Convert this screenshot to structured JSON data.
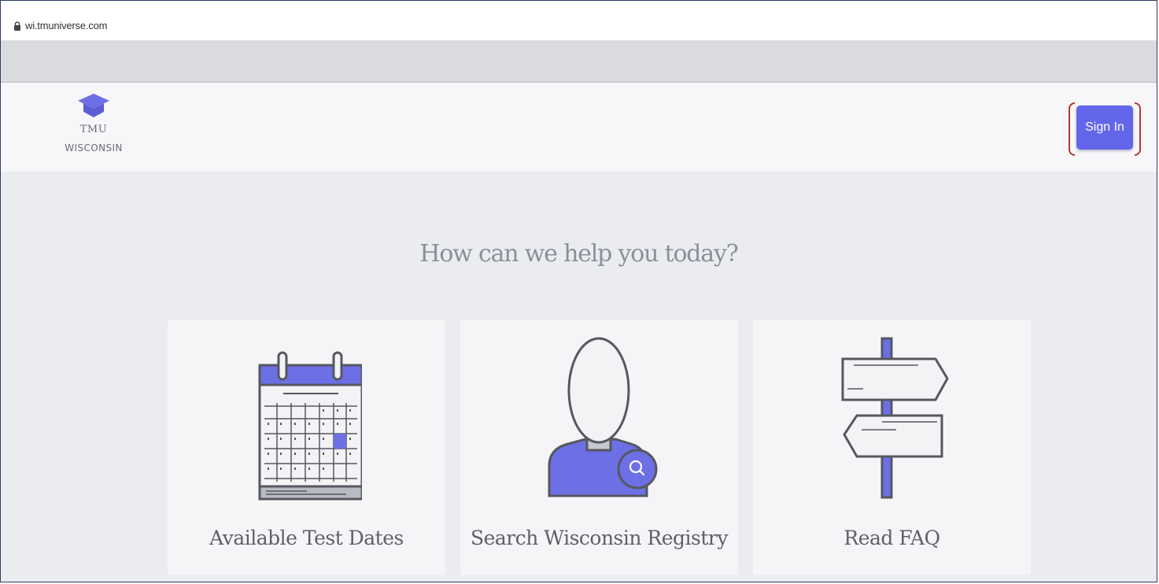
{
  "browser": {
    "url": "wi.tmuniverse.com"
  },
  "header": {
    "logo_abbr": "TMU",
    "logo_state": "WISCONSIN",
    "sign_in_label": "Sign In"
  },
  "main": {
    "headline": "How can we help you today?",
    "cards": [
      {
        "label": "Available Test Dates",
        "icon": "calendar-icon"
      },
      {
        "label": "Search Wisconsin Registry",
        "icon": "person-search-icon"
      },
      {
        "label": "Read FAQ",
        "icon": "signpost-icon"
      }
    ]
  },
  "colors": {
    "accent": "#6366e8",
    "highlight": "#b23a2e",
    "page_background": "#ebecf0"
  }
}
